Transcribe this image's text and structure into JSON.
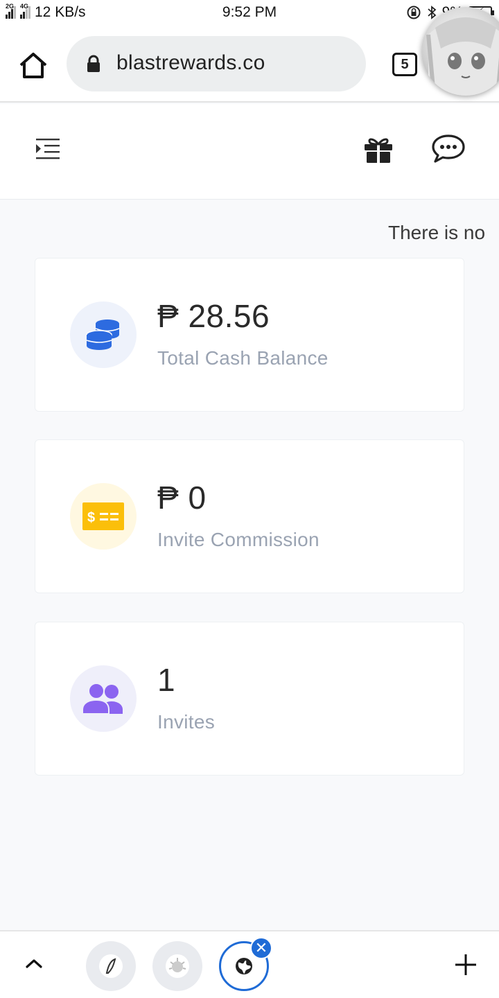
{
  "status_bar": {
    "network_left": "2G",
    "network_right": "4G",
    "speed": "12 KB/s",
    "time": "9:52 PM",
    "battery": "9%"
  },
  "browser": {
    "url": "blastrewards.co",
    "tab_count": "5"
  },
  "site": {
    "marquee_text": "There is no"
  },
  "cards": [
    {
      "value": "₱ 28.56",
      "label": "Total Cash Balance",
      "icon": "coins-icon",
      "icon_bg": "#eef2fb",
      "icon_color": "#2d6be0"
    },
    {
      "value": "₱ 0",
      "label": "Invite Commission",
      "icon": "money-bill-icon",
      "icon_bg": "#fff8e1",
      "icon_color": "#fbbf0a"
    },
    {
      "value": "1",
      "label": "Invites",
      "icon": "users-icon",
      "icon_bg": "#efeffa",
      "icon_color": "#8b64f0"
    }
  ],
  "bottom_bar": {
    "close_glyph": "✕"
  }
}
